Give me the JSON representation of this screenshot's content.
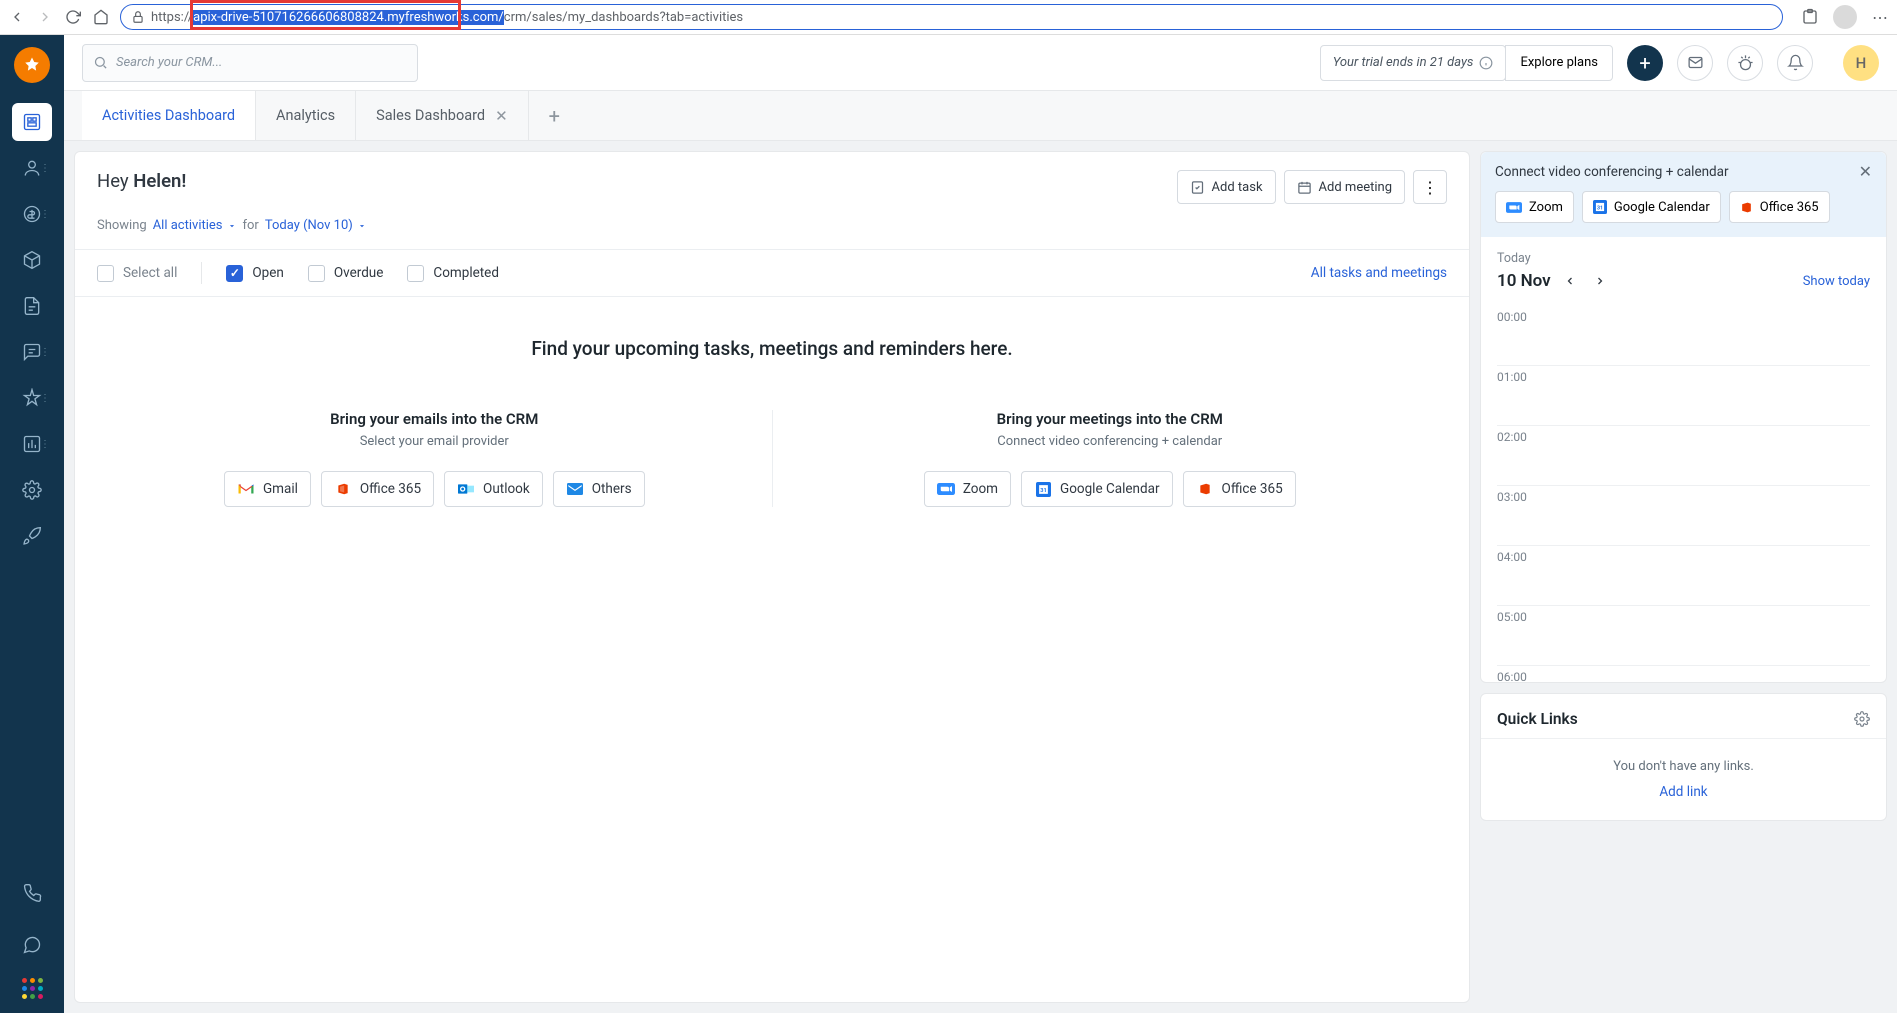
{
  "browser": {
    "url_protocol": "https://",
    "url_highlighted": "apix-drive-510716266606808824.myfreshworks.com/",
    "url_rest": "crm/sales/my_dashboards?tab=activities"
  },
  "header": {
    "search_placeholder": "Search your CRM...",
    "trial_text": "Your trial ends in 21 days",
    "explore_label": "Explore plans",
    "avatar_initial": "H"
  },
  "tabs": [
    {
      "label": "Activities Dashboard",
      "active": true,
      "closable": false
    },
    {
      "label": "Analytics",
      "active": false,
      "closable": false
    },
    {
      "label": "Sales Dashboard",
      "active": false,
      "closable": true
    }
  ],
  "greeting": {
    "hey": "Hey ",
    "name": "Helen!"
  },
  "dash_actions": {
    "add_task": "Add task",
    "add_meeting": "Add meeting"
  },
  "filter": {
    "showing": "Showing",
    "all_activities": "All activities",
    "for": "for",
    "today_date": "Today (Nov 10)"
  },
  "status": {
    "select_all": "Select all",
    "open": "Open",
    "overdue": "Overdue",
    "completed": "Completed",
    "all_tasks": "All tasks and meetings"
  },
  "empty": {
    "title": "Find your upcoming tasks, meetings and reminders here."
  },
  "bring_emails": {
    "heading": "Bring your emails into the CRM",
    "sub": "Select your email provider",
    "providers": [
      "Gmail",
      "Office 365",
      "Outlook",
      "Others"
    ]
  },
  "bring_meetings": {
    "heading": "Bring your meetings into the CRM",
    "sub": "Connect video conferencing + calendar",
    "providers": [
      "Zoom",
      "Google Calendar",
      "Office 365"
    ]
  },
  "connect": {
    "title": "Connect video conferencing + calendar",
    "providers": [
      "Zoom",
      "Google Calendar",
      "Office 365"
    ]
  },
  "calendar": {
    "today_label": "Today",
    "date": "10 Nov",
    "show_today": "Show today",
    "slots": [
      "00:00",
      "01:00",
      "02:00",
      "03:00",
      "04:00",
      "05:00",
      "06:00"
    ]
  },
  "quick_links": {
    "title": "Quick Links",
    "empty": "You don't have any links.",
    "add": "Add link"
  }
}
